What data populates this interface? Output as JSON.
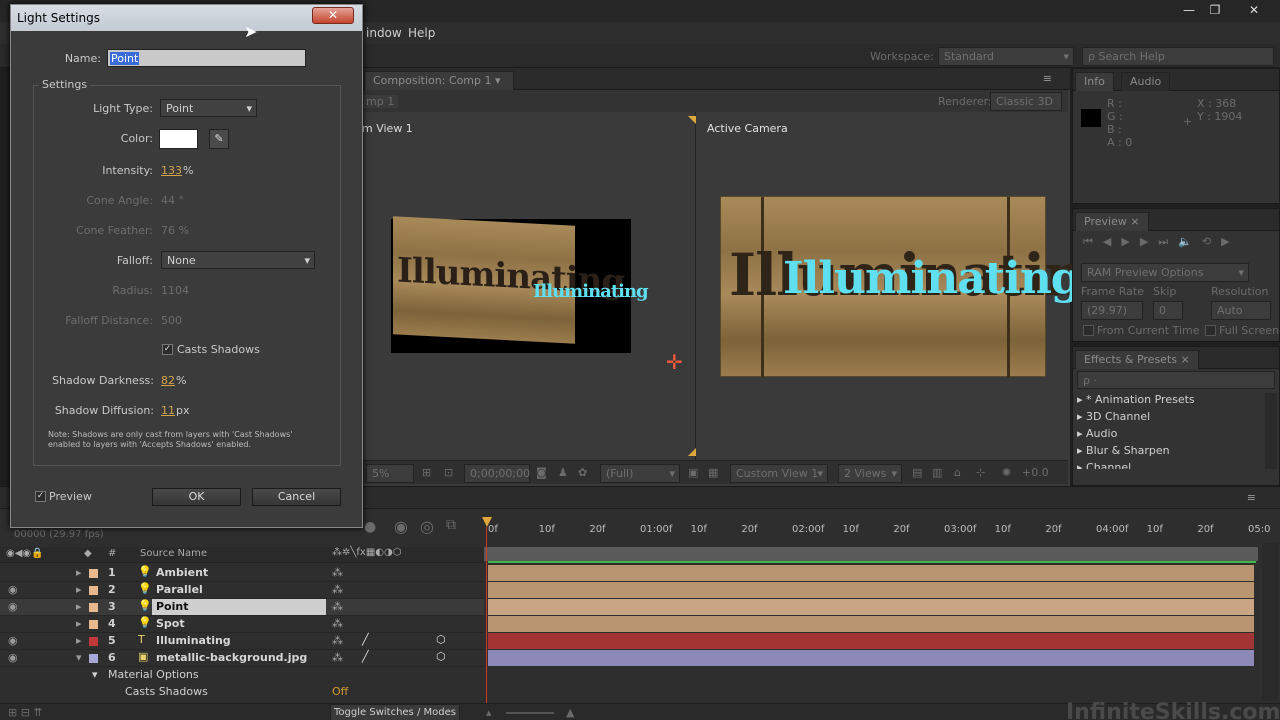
{
  "app": {
    "menu": [
      "indow",
      "Help"
    ],
    "workspace_label": "Workspace:",
    "workspace_value": "Standard",
    "search_placeholder": "Search Help"
  },
  "composition": {
    "tab": "Composition: Comp 1",
    "comp_tab": "mp 1",
    "renderer_label": "Renderer:",
    "renderer_value": "Classic 3D",
    "left_view_label": "m View 1",
    "right_view_label": "Active Camera",
    "sample_text": "Illuminating",
    "bottom_bar": {
      "zoom": "5%",
      "timecode": "0;00;00;00",
      "resolution": "(Full)",
      "view": "Custom View 1",
      "views": "2 Views",
      "exposure": "+0.0"
    }
  },
  "info": {
    "tabs": [
      "Info",
      "Audio"
    ],
    "r": "R :",
    "g": "G :",
    "b": "B :",
    "a": "A : 0",
    "x": "X : 368",
    "y": "Y : 1904"
  },
  "preview": {
    "tab": "Preview",
    "ram_options": "RAM Preview Options",
    "frame_rate_label": "Frame Rate",
    "skip_label": "Skip",
    "resolution_label": "Resolution",
    "frame_rate_value": "(29.97)",
    "skip_value": "0",
    "resolution_value": "Auto",
    "from_current_time": "From Current Time",
    "full_screen": "Full Screen"
  },
  "effects": {
    "tab": "Effects & Presets",
    "search_placeholder": "ρ ·",
    "items": [
      "* Animation Presets",
      "3D Channel",
      "Audio",
      "Blur & Sharpen",
      "Channel"
    ]
  },
  "timeline": {
    "timecode_fps": "00000 (29.97 fps)",
    "source_name_header": "Source Name",
    "hash_header": "#",
    "ruler": [
      "0f",
      "10f",
      "20f",
      "01:00f",
      "10f",
      "20f",
      "02:00f",
      "10f",
      "20f",
      "03:00f",
      "10f",
      "20f",
      "04:00f",
      "10f",
      "20f",
      "05:0"
    ],
    "layers": [
      {
        "num": "1",
        "name": "Ambient",
        "color": "#e8b98c",
        "track": "#b89470",
        "icon": "light-bulb-icon"
      },
      {
        "num": "2",
        "name": "Parallel",
        "color": "#e8b98c",
        "track": "#b89470",
        "icon": "light-bulb-icon"
      },
      {
        "num": "3",
        "name": "Point",
        "color": "#e8b98c",
        "track": "#c9a583",
        "icon": "light-bulb-icon"
      },
      {
        "num": "4",
        "name": "Spot",
        "color": "#e8b98c",
        "track": "#b89470",
        "icon": "light-bulb-icon"
      },
      {
        "num": "5",
        "name": "Illuminating",
        "color": "#c03a3a",
        "track": "#a33434",
        "icon": "text-layer-icon"
      },
      {
        "num": "6",
        "name": "metallic-background.jpg",
        "color": "#a8a8d8",
        "track": "#8c88b8",
        "icon": "footage-icon"
      }
    ],
    "material_options": "Material Options",
    "casts_shadows_label": "Casts Shadows",
    "casts_shadows_value": "Off",
    "toggle_switches": "Toggle Switches / Modes",
    "watermark": "InfiniteSkills.com"
  },
  "dialog": {
    "title": "Light Settings",
    "name_label": "Name:",
    "name_value": "Point",
    "settings_group": "Settings",
    "light_type_label": "Light Type:",
    "light_type_value": "Point",
    "color_label": "Color:",
    "intensity_label": "Intensity:",
    "intensity_value": "133",
    "intensity_unit": "%",
    "cone_angle_label": "Cone Angle:",
    "cone_angle_value": "44 °",
    "cone_feather_label": "Cone Feather:",
    "cone_feather_value": "76 %",
    "falloff_label": "Falloff:",
    "falloff_value": "None",
    "radius_label": "Radius:",
    "radius_value": "1104",
    "falloff_distance_label": "Falloff Distance:",
    "falloff_distance_value": "500",
    "casts_shadows_label": "Casts Shadows",
    "shadow_darkness_label": "Shadow Darkness:",
    "shadow_darkness_value": "82",
    "shadow_darkness_unit": "%",
    "shadow_diffusion_label": "Shadow Diffusion:",
    "shadow_diffusion_value": "11",
    "shadow_diffusion_unit": "px",
    "note": "Note: Shadows are only cast from layers with 'Cast Shadows' enabled to layers with 'Accepts Shadows' enabled.",
    "preview_label": "Preview",
    "ok_label": "OK",
    "cancel_label": "Cancel"
  }
}
